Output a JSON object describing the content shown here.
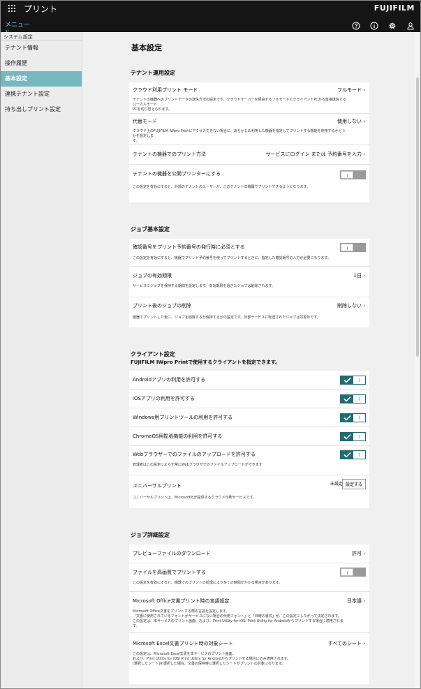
{
  "header": {
    "app_title": "プリント",
    "brand": "FUJIFILM",
    "menu_label": "メニュー ∨",
    "icons": [
      "help-icon",
      "info-icon",
      "settings-icon",
      "user-icon"
    ]
  },
  "sidebar": {
    "section": "システム設定",
    "items": [
      {
        "label": "テナント情報",
        "active": false
      },
      {
        "label": "操作履歴",
        "active": false
      },
      {
        "label": "基本設定",
        "active": true
      },
      {
        "label": "連携テナント設定",
        "active": false
      },
      {
        "label": "持ち出しプリント設定",
        "active": false
      }
    ]
  },
  "main": {
    "title": "基本設定",
    "sections": [
      {
        "title": "テナント運用設定",
        "rows": [
          {
            "title": "クラウド利用プリント モード",
            "value": "フルモード",
            "desc": "テナントの機器へのプリントデータの送信方法の設定です。クラウドサーバーを経由するフルモードとクライアントPCから直接送信するローカルモード\nPCを切り替えられます。"
          },
          {
            "title": "代替モード",
            "value": "使用しない",
            "desc": "クラウド上のFUJIFILM IWpro Printにアクセスできない場合に、あらかじめ利用した機器を指定してプリントする機能を使用するかどうかを設定しま\nす。"
          },
          {
            "title": "テナントの機器でのプリント方法",
            "value": "サービスにログイン または 予約番号を入力"
          },
          {
            "title": "テナントの機器を公開プリンターにする",
            "toggle": false,
            "desc": "この設定を有効にすると、外部のテナントのユーザーが、このテナントの機器でプリントできるようになります。"
          }
        ]
      },
      {
        "title": "ジョブ基本設定",
        "rows": [
          {
            "title": "確認番号をプリント予約番号の発行時に必須とする",
            "toggle": false,
            "desc": "この設定を有効にすると、機器でプリント予約番号を使ってプリントするときに、指定した確認番号の入力が必要になります。"
          },
          {
            "title": "ジョブの有効期限",
            "value": "1日",
            "desc": "サービスにジョブを保持する期間を設定します。有効期限を過ぎたジョブは削除されます。"
          },
          {
            "title": "プリント後のジョブの削除",
            "value": "削除しない",
            "desc": "機器でプリントした後に、ジョブを削除するか保持するかの設定です。外部サービスに転送されたジョブは対象外です。"
          }
        ]
      },
      {
        "title": "クライアント設定",
        "subtitle": "FUJIFILM IWpro Printで使用するクライアントを指定できます。",
        "rows": [
          {
            "title": "Androidアプリの利用を許可する",
            "toggle": true
          },
          {
            "title": "iOSアプリの利用を許可する",
            "toggle": true
          },
          {
            "title": "Windows用プリントツールの利用を許可する",
            "toggle": true
          },
          {
            "title": "ChromeOS用拡張機能の利用を許可する",
            "toggle": true
          },
          {
            "title": "Webブラウザーでのファイルのアップロードを許可する",
            "toggle": true,
            "desc": "管理者はこの設定によらず常にWebブラウザでのファイルアップロードができます"
          },
          {
            "title": "ユニバーサルプリント",
            "status": "未設定",
            "button": "設定する",
            "desc": "ユニバーサルプリントは、Microsoft社が提供するクラウド印刷サービスです。"
          }
        ]
      },
      {
        "title": "ジョブ詳細設定",
        "rows": [
          {
            "title": "プレビューファイルのダウンロード",
            "value": "許可"
          },
          {
            "title": "ファイルを高画質でプリントする",
            "toggle": false,
            "desc": "この設定を有効にすると、機器でのプリントの処理により多くの時間がかかる場合があります。"
          },
          {
            "title": "Microsoft Office文書プリント時の言語設定",
            "value": "日本語",
            "desc": "Microsoft Office文書をプリントする際の言語を設定します。\n「文書に使用されているフォントがサービスにない場合の代用フォント」と「日時の書式」が、この設定にしたがって決定されます。\nこの設定は、本サービスのプリント画面、および、Print Utility for iOS/ Print Utility for Androidからプリントする場合に適用されます。"
          },
          {
            "title": "Microsoft Excel文書プリント時の対象シート",
            "value": "すべてのシート",
            "desc": "この設定は、Microsoft Excel文書を本サービスのプリント画面、\nおよび、Print Utility for iOS/ Print Utility for Androidからプリントする場合にのみ適用されます。\n[選択したシート]を選択した場合、文書の保存時に選択したシートがプリントの対象になります。"
          }
        ]
      }
    ]
  }
}
